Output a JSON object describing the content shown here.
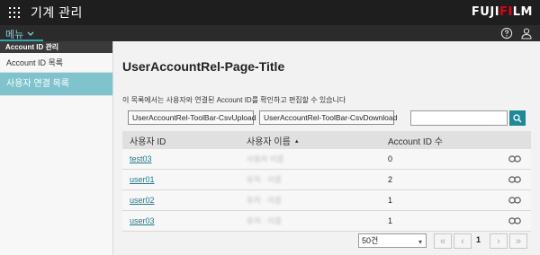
{
  "header": {
    "app_title": "기계 관리",
    "brand_text": "FUJIFILM",
    "brand_prefix": "FUJI",
    "brand_accent": "FI",
    "brand_suffix": "LM",
    "brand_color": "#e60012"
  },
  "menubar": {
    "menu_label": "메뉴",
    "accent_color": "#2fa7b5"
  },
  "sidebar": {
    "section_title": "Account ID 관리",
    "items": [
      {
        "label": "Account ID 목록",
        "active": false
      },
      {
        "label": "사용자 연결 목록",
        "active": true
      }
    ]
  },
  "main": {
    "title": "UserAccountRel-Page-Title",
    "description": "이 목록에서는 사용자와 연결된 Account ID를 확인하고 편집할 수 있습니다",
    "toolbar": {
      "upload_label": "UserAccountRel-ToolBar-CsvUpload",
      "download_label": "UserAccountRel-ToolBar-CsvDownload"
    },
    "search": {
      "value": "",
      "placeholder": ""
    },
    "table": {
      "headers": [
        "사용자 ID",
        "사용자 이름",
        "Account ID 수",
        ""
      ],
      "sort_indicator": "▲",
      "rows": [
        {
          "user_id": "test03",
          "user_name": "사용자 이름",
          "count": "0"
        },
        {
          "user_id": "user01",
          "user_name": "유저 · 이름",
          "count": "2"
        },
        {
          "user_id": "user02",
          "user_name": "유저 · 이름",
          "count": "1"
        },
        {
          "user_id": "user03",
          "user_name": "유저 · 이름",
          "count": "1"
        }
      ]
    },
    "pagination": {
      "page_size": "50건",
      "current_page": "1"
    }
  }
}
